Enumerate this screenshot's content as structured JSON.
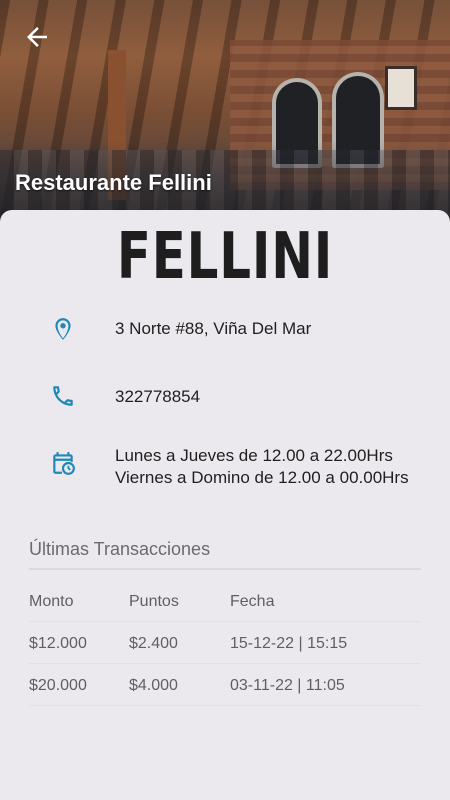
{
  "header": {
    "title": "Restaurante Fellini",
    "back_icon": "arrow-left-icon"
  },
  "logo_text": "FELLINI",
  "info": {
    "address": "3 Norte #88, Viña Del Mar",
    "phone": "322778854",
    "hours": "Lunes a Jueves de 12.00 a 22.00Hrs Viernes a Domino de 12.00 a 00.00Hrs"
  },
  "transactions": {
    "title": "Últimas Transacciones",
    "columns": [
      "Monto",
      "Puntos",
      "Fecha"
    ],
    "rows": [
      [
        "$12.000",
        "$2.400",
        "15-12-22 | 15:15"
      ],
      [
        "$20.000",
        "$4.000",
        "03-11-22 | 11:05"
      ]
    ]
  },
  "colors": {
    "accent": "#1e88b6",
    "background": "#ece9ee"
  }
}
